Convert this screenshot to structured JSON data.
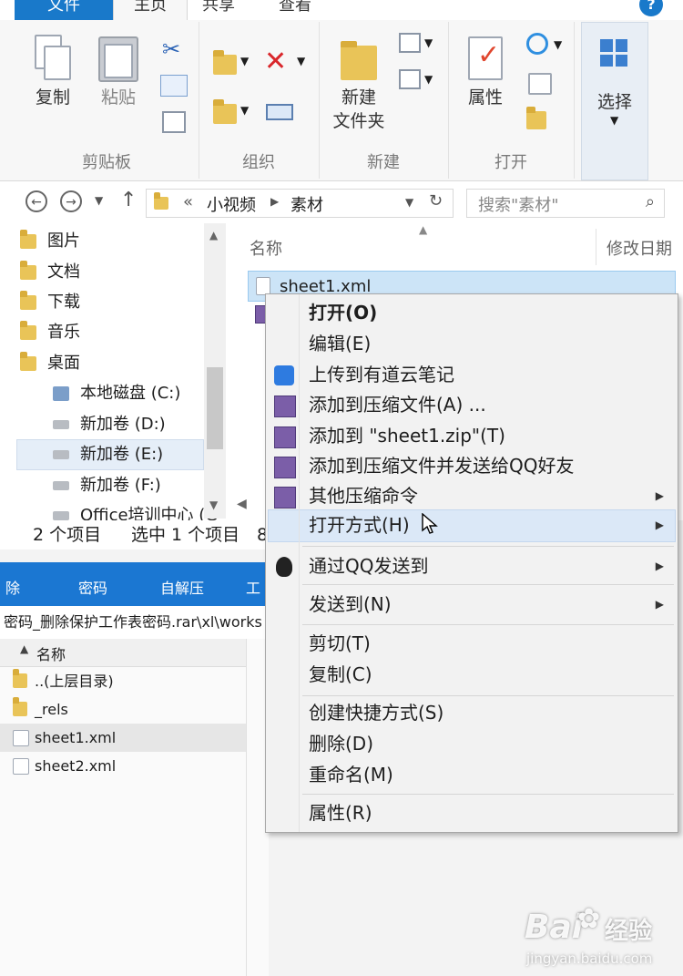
{
  "ribbon": {
    "tabs": [
      "文件",
      "主页",
      "共享",
      "查看"
    ],
    "help_icon": "?",
    "clipboard": {
      "copy": "复制",
      "paste": "粘贴",
      "label": "剪贴板"
    },
    "organize": {
      "label": "组织"
    },
    "new": {
      "new_folder_line1": "新建",
      "new_folder_line2": "文件夹",
      "label": "新建"
    },
    "open": {
      "properties": "属性",
      "label": "打开"
    },
    "select": {
      "label": "选择"
    }
  },
  "address": {
    "chevron": "«",
    "crumbs": [
      "小视频",
      "素材"
    ],
    "search_placeholder": "搜索\"素材\""
  },
  "nav": {
    "items": [
      "图片",
      "文档",
      "下载",
      "音乐",
      "桌面",
      "本地磁盘 (C:)",
      "新加卷 (D:)",
      "新加卷 (E:)",
      "新加卷 (F:)",
      "Office培训中心 (G"
    ]
  },
  "filelist": {
    "col_name": "名称",
    "col_date": "修改日期",
    "selected_file": "sheet1.xml"
  },
  "status": {
    "count": "2 个项目",
    "selected": "选中 1 个项目",
    "size": "8"
  },
  "archive": {
    "toolbar": [
      "除",
      "密码",
      "自解压",
      "工"
    ],
    "path": "密码_删除保护工作表密码.rar\\xl\\works",
    "col_name": "名称",
    "rows": [
      "..(上层目录)",
      "_rels",
      "sheet1.xml",
      "sheet2.xml"
    ]
  },
  "menu": {
    "open": "打开(O)",
    "edit": "编辑(E)",
    "youdao": "上传到有道云笔记",
    "add_archive": "添加到压缩文件(A) ...",
    "add_zip": "添加到 \"sheet1.zip\"(T)",
    "add_send_qq": "添加到压缩文件并发送给QQ好友",
    "other_compress": "其他压缩命令",
    "open_with": "打开方式(H)",
    "send_qq": "通过QQ发送到",
    "send_to": "发送到(N)",
    "cut": "剪切(T)",
    "copy": "复制(C)",
    "shortcut": "创建快捷方式(S)",
    "delete": "删除(D)",
    "rename": "重命名(M)",
    "properties": "属性(R)"
  },
  "watermark": {
    "brand": "Bai",
    "brand2": "经验",
    "url": "jingyan.baidu.com"
  },
  "colors": {
    "accent": "#1979ca",
    "archive_bar": "#1b77d2",
    "hover": "#dbe8f7"
  }
}
